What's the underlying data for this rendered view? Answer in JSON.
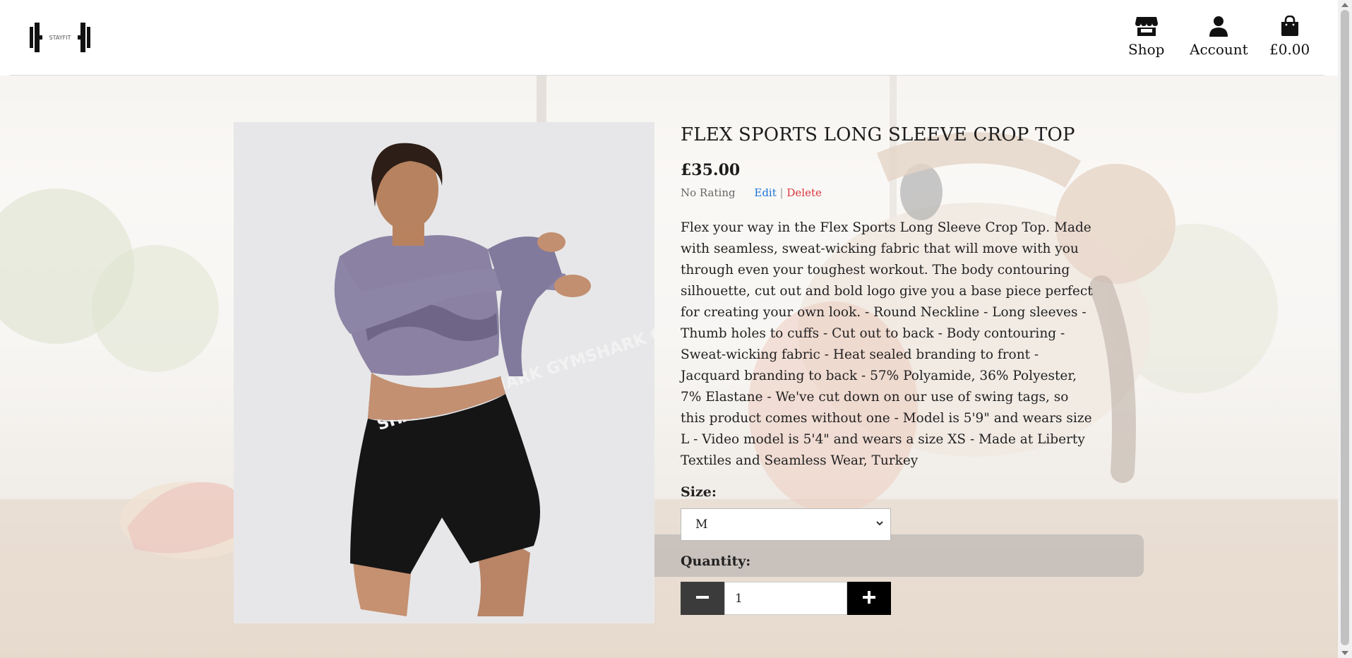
{
  "brand": {
    "logo_text": "STAYFIT"
  },
  "nav": {
    "shop": "Shop",
    "account": "Account",
    "bag_total": "£0.00"
  },
  "product": {
    "title": "FLEX SPORTS LONG SLEEVE CROP TOP",
    "price": "£35.00",
    "rating": "No Rating",
    "edit": "Edit",
    "separator": "|",
    "delete": "Delete",
    "description": "Flex your way in the Flex Sports Long Sleeve Crop Top. Made with seamless, sweat-wicking fabric that will move with you through even your toughest workout. The body contouring silhouette, cut out and bold logo give you a base piece perfect for creating your own look. - Round Neckline - Long sleeves - Thumb holes to cuffs - Cut out to back - Body contouring - Sweat-wicking fabric - Heat sealed branding to front - Jacquard branding to back - 57% Polyamide, 36% Polyester, 7% Elastane - We've cut down on our use of swing tags, so this product comes without one - Model is 5'9\" and wears size L - Video model is 5'4\" and wears a size XS - Made at Liberty Textiles and Seamless Wear, Turkey",
    "image_text": "SHARK GYMSHARK GYMSHARK G"
  },
  "size": {
    "label": "Size:",
    "selected": "M"
  },
  "quantity": {
    "label": "Quantity:",
    "value": "1"
  },
  "colors": {
    "edit_link": "#1a73d8",
    "delete_link": "#d9363e",
    "top_purple": "#8b82a3",
    "shorts_black": "#151515"
  },
  "icons": [
    "store-icon",
    "user-icon",
    "bag-icon",
    "minus-icon",
    "plus-icon",
    "chevron-down-icon"
  ]
}
